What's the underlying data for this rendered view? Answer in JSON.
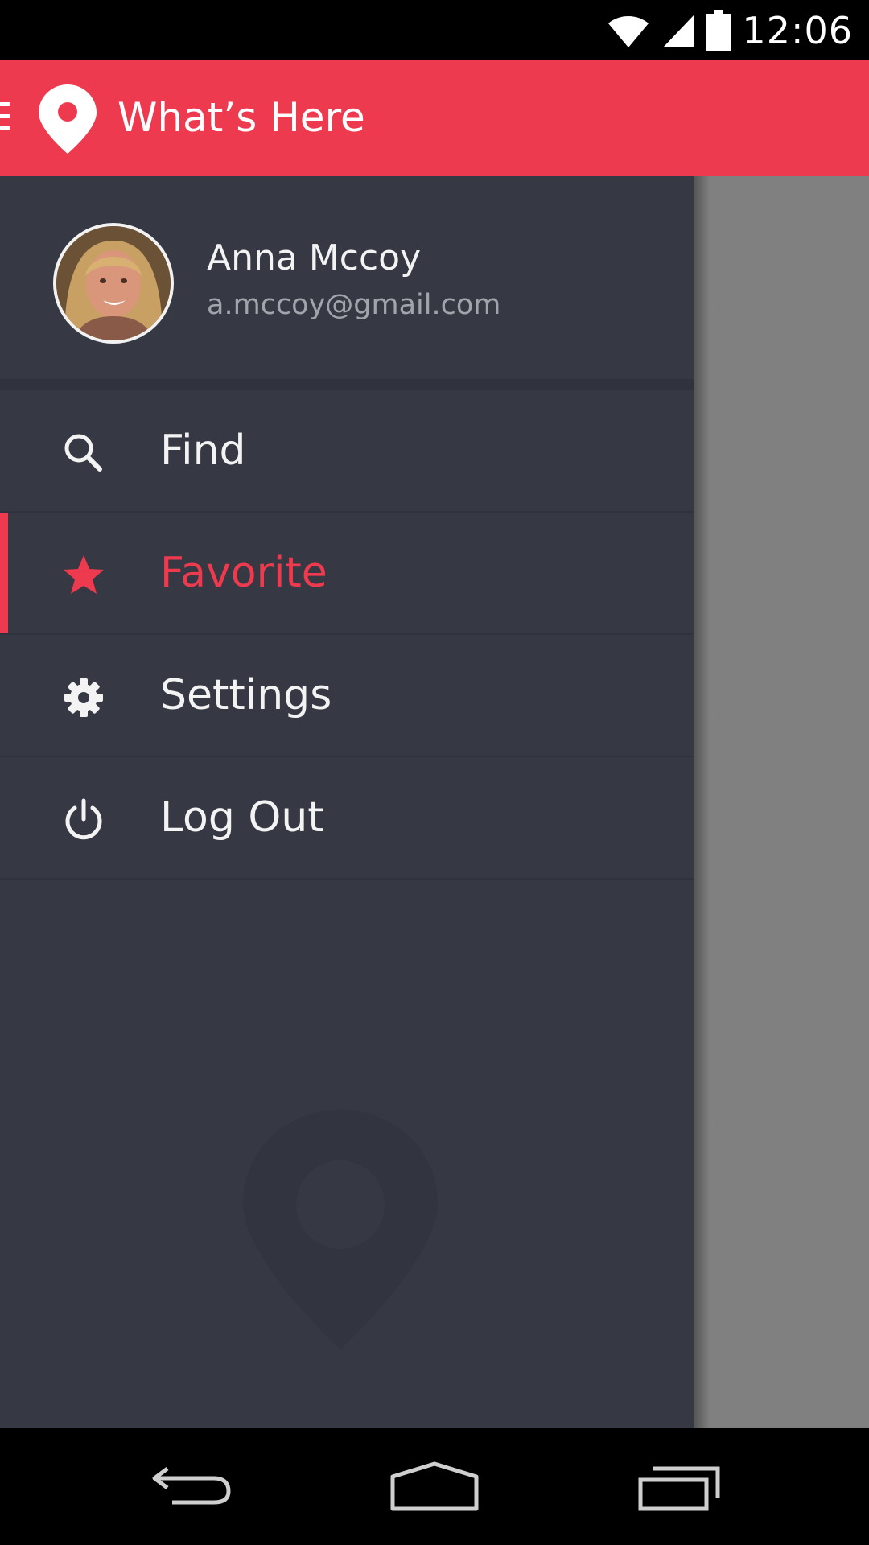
{
  "status_bar": {
    "time": "12:06",
    "icons": [
      "wifi-icon",
      "signal-icon",
      "battery-icon"
    ]
  },
  "app_bar": {
    "title": "What’s Here",
    "icons": [
      "menu-icon",
      "location-pin-icon"
    ],
    "background_color": "#ee3a4e"
  },
  "drawer": {
    "user": {
      "name": "Anna Mccoy",
      "email": "a.mccoy@gmail.com"
    },
    "items": [
      {
        "label": "Find",
        "icon": "search-icon",
        "active": false
      },
      {
        "label": "Favorite",
        "icon": "star-icon",
        "active": true
      },
      {
        "label": "Settings",
        "icon": "gear-icon",
        "active": false
      },
      {
        "label": "Log Out",
        "icon": "power-icon",
        "active": false
      }
    ],
    "background_color": "#363944",
    "accent_color": "#ee3a4e"
  },
  "nav_bar": {
    "buttons": [
      "back-icon",
      "home-icon",
      "recent-apps-icon"
    ]
  }
}
